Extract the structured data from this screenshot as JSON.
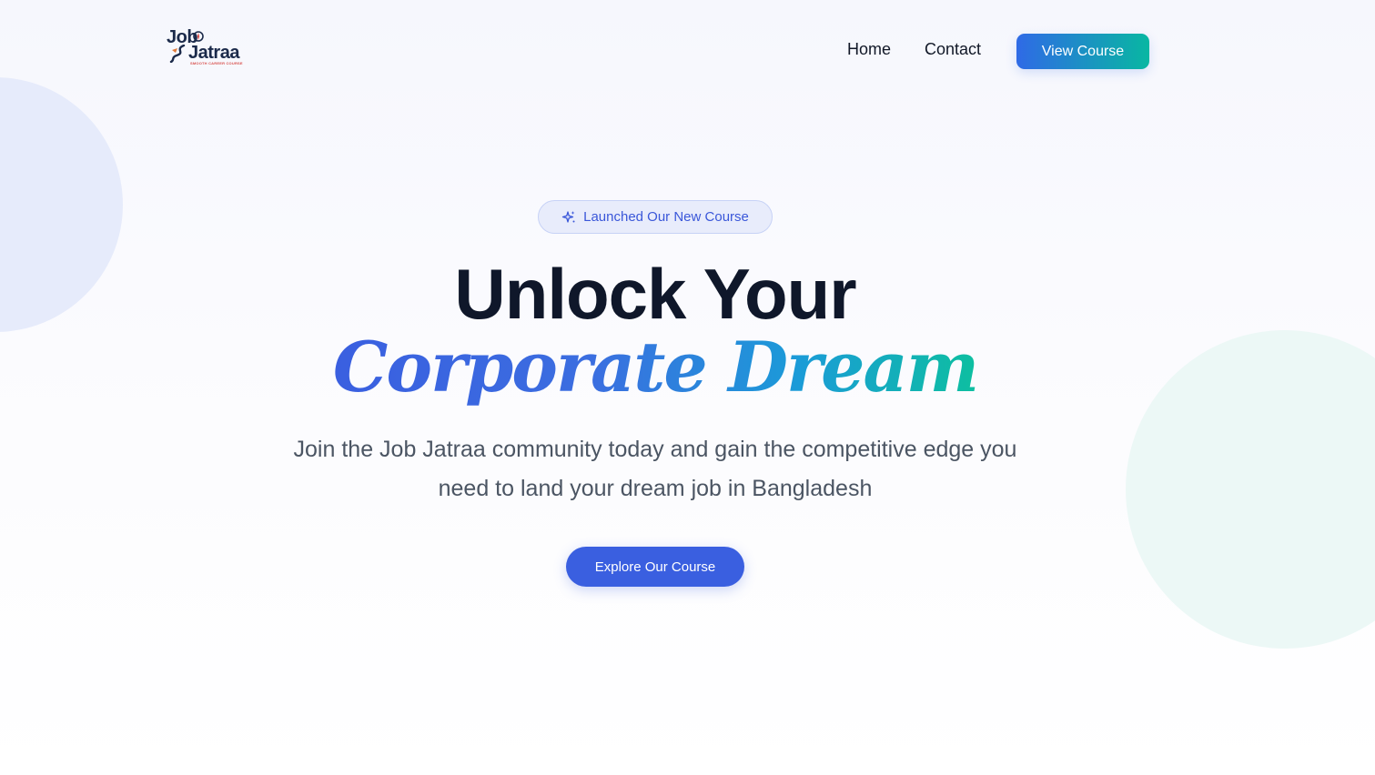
{
  "brand": {
    "logo_word_1": "Job",
    "logo_word_2": "Jatraa",
    "logo_tagline": "SMOOTH CAREER COURSE",
    "colors": {
      "navy": "#1b2a4a",
      "primary_blue": "#3a5fe0",
      "teal": "#08b7a2",
      "heading": "#0f172a",
      "body_text": "#4b5563"
    }
  },
  "nav": {
    "items": [
      {
        "label": "Home"
      },
      {
        "label": "Contact"
      }
    ],
    "cta_label": "View Course"
  },
  "hero": {
    "badge": {
      "icon": "sparkles-icon",
      "label": "Launched Our New Course"
    },
    "headline": "Unlock Your",
    "script_headline": "Corporate Dream",
    "subtitle": "Join the Job Jatraa community today and gain the competitive edge you need to land your dream job in Bangladesh",
    "cta_label": "Explore Our Course"
  }
}
